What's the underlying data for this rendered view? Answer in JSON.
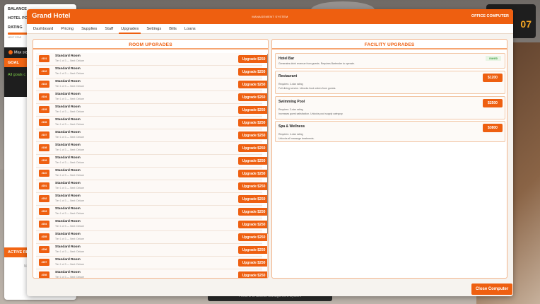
{
  "hud": {
    "balance_label": "BALANCE",
    "hotel_points_label": "HOTEL POI",
    "rating_label": "RATING",
    "next_star": "NEXT STAR",
    "max_stars": "Max sta",
    "goal_label": "GOAL",
    "goal_text": "All goals c",
    "active_requests": "ACTIVE REQ",
    "active_requests_body": "Na",
    "clock_text": "07",
    "notice_text": "Press E to access Management System"
  },
  "window": {
    "title": "Grand Hotel",
    "subtitle": "MANAGEMENT SYSTEM",
    "computer_label": "OFFICE COMPUTER",
    "close_label": "Close Computer"
  },
  "tabs": [
    {
      "label": "Dashboard"
    },
    {
      "label": "Pricing"
    },
    {
      "label": "Supplies"
    },
    {
      "label": "Staff"
    },
    {
      "label": "Upgrades"
    },
    {
      "label": "Settings"
    },
    {
      "label": "Bills"
    },
    {
      "label": "Loans"
    }
  ],
  "active_tab": "Upgrades",
  "room_upgrades": {
    "heading": "ROOM UPGRADES",
    "rooms": [
      {
        "number": "#101",
        "name": "Standard Room",
        "tier": "Tier 1 of 3 — Next: Deluxe",
        "button": "Upgrade $250"
      },
      {
        "number": "#102",
        "name": "Standard Room",
        "tier": "Tier 1 of 3 — Next: Deluxe",
        "button": "Upgrade $250"
      },
      {
        "number": "#103",
        "name": "Standard Room",
        "tier": "Tier 1 of 3 — Next: Deluxe",
        "button": "Upgrade $250"
      },
      {
        "number": "#104",
        "name": "Standard Room",
        "tier": "Tier 1 of 3 — Next: Deluxe",
        "button": "Upgrade $250"
      },
      {
        "number": "#105",
        "name": "Standard Room",
        "tier": "Tier 1 of 3 — Next: Deluxe",
        "button": "Upgrade $250"
      },
      {
        "number": "#106",
        "name": "Standard Room",
        "tier": "Tier 1 of 3 — Next: Deluxe",
        "button": "Upgrade $250"
      },
      {
        "number": "#107",
        "name": "Standard Room",
        "tier": "Tier 1 of 3 — Next: Deluxe",
        "button": "Upgrade $250"
      },
      {
        "number": "#108",
        "name": "Standard Room",
        "tier": "Tier 1 of 3 — Next: Deluxe",
        "button": "Upgrade $250"
      },
      {
        "number": "#109",
        "name": "Standard Room",
        "tier": "Tier 1 of 3 — Next: Deluxe",
        "button": "Upgrade $250"
      },
      {
        "number": "#110",
        "name": "Standard Room",
        "tier": "Tier 1 of 3 — Next: Deluxe",
        "button": "Upgrade $250"
      },
      {
        "number": "#201",
        "name": "Standard Room",
        "tier": "Tier 1 of 3 — Next: Deluxe",
        "button": "Upgrade $250"
      },
      {
        "number": "#202",
        "name": "Standard Room",
        "tier": "Tier 1 of 3 — Next: Deluxe",
        "button": "Upgrade $250"
      },
      {
        "number": "#203",
        "name": "Standard Room",
        "tier": "Tier 1 of 3 — Next: Deluxe",
        "button": "Upgrade $250"
      },
      {
        "number": "#204",
        "name": "Standard Room",
        "tier": "Tier 1 of 3 — Next: Deluxe",
        "button": "Upgrade $250"
      },
      {
        "number": "#205",
        "name": "Standard Room",
        "tier": "Tier 1 of 3 — Next: Deluxe",
        "button": "Upgrade $250"
      },
      {
        "number": "#206",
        "name": "Standard Room",
        "tier": "Tier 1 of 3 — Next: Deluxe",
        "button": "Upgrade $250"
      },
      {
        "number": "#207",
        "name": "Standard Room",
        "tier": "Tier 1 of 3 — Next: Deluxe",
        "button": "Upgrade $250"
      },
      {
        "number": "#208",
        "name": "Standard Room",
        "tier": "Tier 1 of 3 — Next: Deluxe",
        "button": "Upgrade $250"
      }
    ]
  },
  "facility_upgrades": {
    "heading": "FACILITY UPGRADES",
    "items": [
      {
        "name": "Hotel Bar",
        "status": "OWNED",
        "lines": [
          "Generates drink revenue from guests. Requires Bartender to operate."
        ]
      },
      {
        "name": "Restaurant",
        "button": "$1200",
        "lines": [
          "Requires: 2-star rating",
          "Full dining service. Unlocks food orders from guests."
        ]
      },
      {
        "name": "Swimming Pool",
        "button": "$2500",
        "lines": [
          "Requires: 3-star rating",
          "Increases guest satisfaction. Unlocks pool supply category."
        ]
      },
      {
        "name": "Spa & Wellness",
        "button": "$3800",
        "lines": [
          "Requires: 4-star rating",
          "Unlocks all massage treatments."
        ]
      }
    ]
  },
  "colors": {
    "accent": "#ee5f10",
    "owned_green": "#43a047"
  }
}
